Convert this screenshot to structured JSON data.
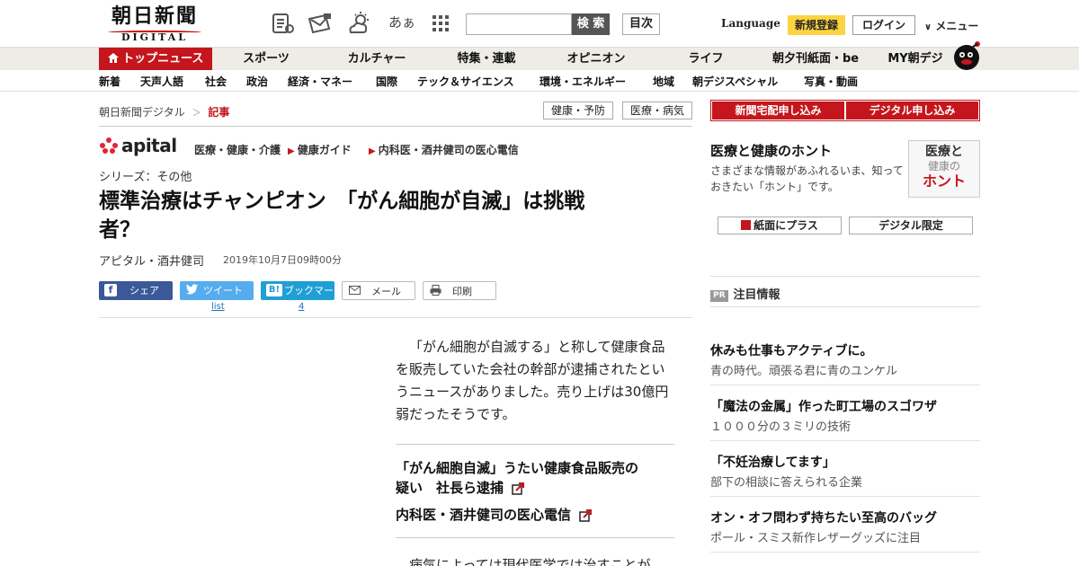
{
  "header": {
    "logo_main": "朝日新聞",
    "logo_sub": "DIGITAL",
    "aa_label": "あぁ",
    "search_button": "検 索",
    "search_placeholder": "",
    "index_button": "目次",
    "language": "Language",
    "register": "新規登録",
    "login": "ログイン",
    "menu": "メニュー"
  },
  "mainnav": [
    "トップニュース",
    "スポーツ",
    "カルチャー",
    "特集・連載",
    "オピニオン",
    "ライフ",
    "朝夕刊紙面・be",
    "MY朝デジ"
  ],
  "subnav": [
    "新着",
    "天声人語",
    "社会",
    "政治",
    "経済・マネー",
    "国際",
    "テック＆サイエンス",
    "環境・エネルギー",
    "地域",
    "朝デジスペシャル",
    "写真・動画"
  ],
  "breadcrumb": {
    "home": "朝日新聞デジタル",
    "sep": "＞",
    "current": "記事"
  },
  "tags": [
    "健康・予防",
    "医療・病気"
  ],
  "apital": {
    "logo": "apital",
    "category": "医療・健康・介護",
    "link1": "健康ガイド",
    "link2": "内科医・酒井健司の医心電信"
  },
  "article": {
    "series": "シリーズ：その他",
    "headline_line1": "標準治療はチャンピオン　「がん細胞が自滅」は挑戦",
    "headline_line2": "者？",
    "byline": "アピタル・酒井健司",
    "date": "2019年10月7日09時00分",
    "share": {
      "facebook": "シェア",
      "twitter": "ツイート",
      "twitter_count": "list",
      "hatena": "ブックマーク",
      "hatena_count": "4",
      "mail": "メール",
      "print": "印刷"
    },
    "body_paragraph": "「がん細胞が自滅する」と称して健康食品を販売していた会社の幹部が逮捕されたというニュースがありました。売り上げは30億円弱だったそうです。",
    "related1_line1": "「がん細胞自滅」うたい健康食品販売の",
    "related1_line2": "疑い　社長ら逮捕",
    "related2": "内科医・酒井健司の医心電信",
    "body_next": "　病気によっては現代医学では治すことが"
  },
  "sidebar": {
    "subscribe_paper": "新聞宅配申し込み",
    "subscribe_digital": "デジタル申し込み",
    "feature_title": "医療と健康のホント",
    "feature_desc": "さまざまな情報があふれるいま、知っておきたい「ホント」です。",
    "honto_a": "医療と",
    "honto_b": "健康の",
    "honto_c": "ホント",
    "btn_paper_plus": "紙面にプラス",
    "btn_digital_only": "デジタル限定",
    "pr_badge": "PR",
    "pr_title": "注目情報",
    "ads": [
      {
        "title": "休みも仕事もアクティブに。",
        "sub": "青の時代。頑張る君に青のユンケル"
      },
      {
        "title": "「魔法の金属」作った町工場のスゴワザ",
        "sub": "１０００分の３ミリの技術"
      },
      {
        "title": "「不妊治療してます」",
        "sub": "部下の相談に答えられる企業"
      },
      {
        "title": "オン・オフ問わず持ちたい至高のバッグ",
        "sub": "ポール・スミス新作レザーグッズに注目"
      }
    ]
  },
  "colors": {
    "brand_red": "#c4161c",
    "register_yellow": "#fcd341",
    "facebook": "#3b5998",
    "twitter": "#55acee",
    "hatena": "#1f9fd5"
  }
}
